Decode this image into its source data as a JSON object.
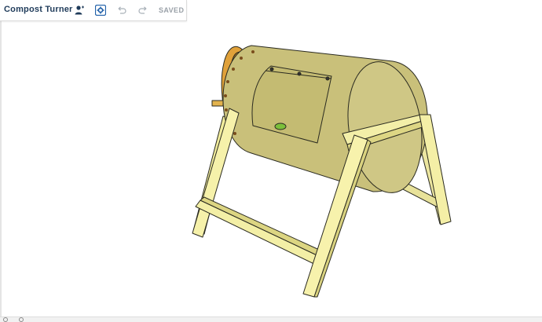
{
  "app": {
    "document_title": "Compost Turner",
    "save_status": "SAVED"
  },
  "toolbar": {
    "buttons": [
      {
        "name": "share-user",
        "icon": "user-plus-icon",
        "active": false
      },
      {
        "name": "settings",
        "icon": "gear-icon",
        "active": true
      },
      {
        "name": "undo",
        "icon": "undo-icon",
        "active": false
      },
      {
        "name": "redo",
        "icon": "redo-icon",
        "active": false
      }
    ]
  },
  "colors": {
    "title": "#1f3b5a",
    "icon_active": "#1f5fa8",
    "icon_muted": "#a8b0b8",
    "drum": "#c9c07a",
    "drum_end": "#d6cf8e",
    "drum_shadow": "#b3aa63",
    "ring": "#e0a13a",
    "ring_bolt": "#7a4d1c",
    "lumber": "#f1ec9c",
    "lumber_shade": "#d8d17c",
    "handle": "#7bbf3a",
    "outline": "#2a2a20"
  },
  "model": {
    "subject": "compost tumbler drum on wooden A-frame stand"
  }
}
